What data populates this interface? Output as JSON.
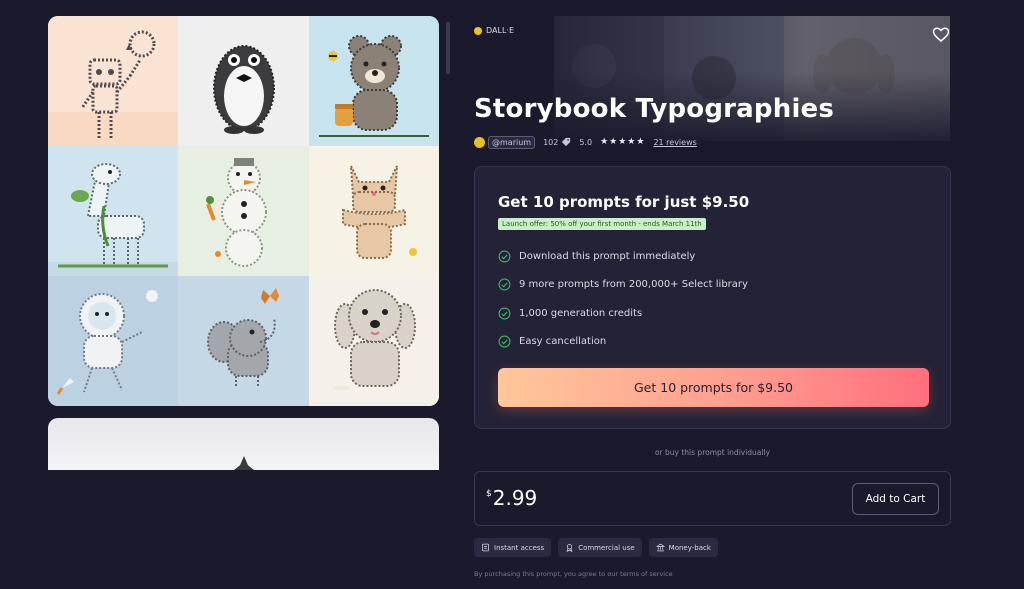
{
  "gallery": {
    "tiles": [
      {
        "name": "robot",
        "bg": "#fbe3d4"
      },
      {
        "name": "penguin",
        "bg": "#eeeeee"
      },
      {
        "name": "bear",
        "bg": "#c7e4ee"
      },
      {
        "name": "giraffe",
        "bg": "#cfe4ee"
      },
      {
        "name": "snowman",
        "bg": "#e6efe2"
      },
      {
        "name": "cat",
        "bg": "#f6f2e6"
      },
      {
        "name": "astronaut",
        "bg": "#bcd2e2"
      },
      {
        "name": "elephant",
        "bg": "#c4d8e6"
      },
      {
        "name": "puppy",
        "bg": "#f5f1ea"
      }
    ]
  },
  "product": {
    "model": "DALL·E",
    "title": "Storybook Typographies",
    "author": "@marium",
    "views": "102",
    "rating": "5.0",
    "stars": "★★★★★",
    "reviews": "21 reviews",
    "favorite_icon": "heart-icon"
  },
  "offer": {
    "heading": "Get 10 prompts for just $9.50",
    "badge": "Launch offer: 50% off your first month - ends March 11th",
    "features": [
      "Download this prompt immediately",
      "9 more prompts from 200,000+ Select library",
      "1,000 generation credits",
      "Easy cancellation"
    ],
    "cta": "Get 10 prompts for $9.50"
  },
  "individual": {
    "or_text": "or buy this prompt individually",
    "currency": "$",
    "price": "2.99",
    "add_to_cart": "Add to Cart"
  },
  "perks": [
    "Instant access",
    "Commercial use",
    "Money-back"
  ],
  "terms": "By purchasing this prompt, you agree to our terms of service",
  "colors": {
    "background": "#1b1a2d",
    "card": "#232236",
    "check_green": "#39b86a",
    "cta_start": "#ffc79a",
    "cta_end": "#ff6f7d"
  }
}
